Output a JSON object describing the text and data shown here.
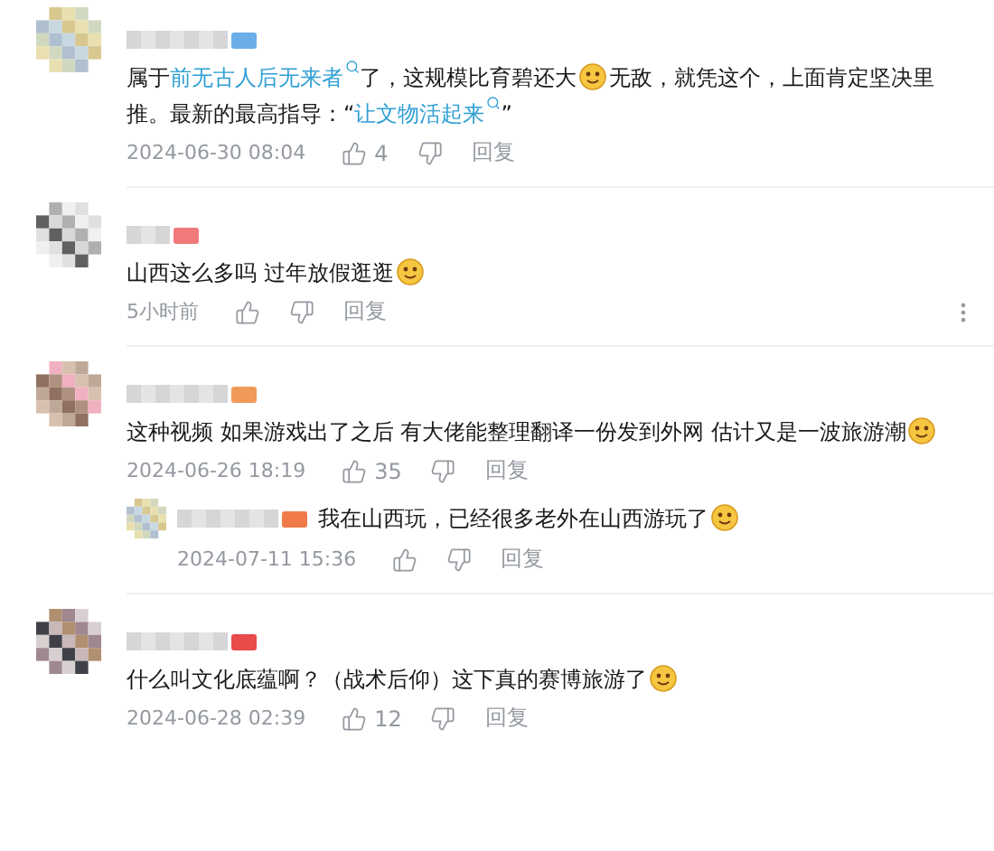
{
  "comments": [
    {
      "content": [
        {
          "kind": "text",
          "text": "属于"
        },
        {
          "kind": "link",
          "text": "前无古人后无来者"
        },
        {
          "kind": "text",
          "text": "了，这规模比育碧还大"
        },
        {
          "kind": "emoji"
        },
        {
          "kind": "text",
          "text": "无敌，就凭这个，上面肯定坚决里推。最新的最高指导：“"
        },
        {
          "kind": "link",
          "text": "让文物活起来"
        },
        {
          "kind": "text",
          "text": "”"
        }
      ],
      "time": "2024-06-30 08:04",
      "likes": "4",
      "reply_label": "回复",
      "more_menu": false
    },
    {
      "content": [
        {
          "kind": "text",
          "text": "山西这么多吗 过年放假逛逛"
        },
        {
          "kind": "emoji"
        }
      ],
      "time": "5小时前",
      "reply_label": "回复",
      "more_menu": true
    },
    {
      "content": [
        {
          "kind": "text",
          "text": "这种视频 如果游戏出了之后 有大佬能整理翻译一份发到外网 估计又是一波旅游潮"
        },
        {
          "kind": "emoji"
        }
      ],
      "time": "2024-06-26 18:19",
      "likes": "35",
      "reply_label": "回复",
      "more_menu": false,
      "replies": [
        {
          "content": [
            {
              "kind": "text",
              "text": "我在山西玩，已经很多老外在山西游玩了"
            },
            {
              "kind": "emoji"
            }
          ],
          "time": "2024-07-11 15:36",
          "reply_label": "回复"
        }
      ]
    },
    {
      "content": [
        {
          "kind": "text",
          "text": "什么叫文化底蕴啊？（战术后仰）这下真的赛博旅游了"
        },
        {
          "kind": "emoji"
        }
      ],
      "time": "2024-06-28 02:39",
      "likes": "12",
      "reply_label": "回复",
      "more_menu": false
    }
  ]
}
